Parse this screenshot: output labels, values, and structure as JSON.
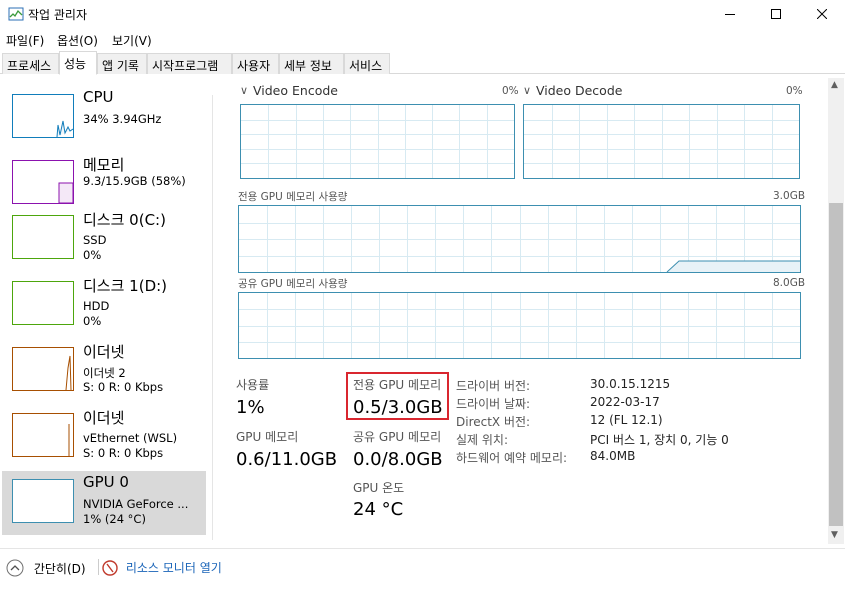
{
  "window": {
    "title": "작업 관리자"
  },
  "menu": [
    "파일(F)",
    "옵션(O)",
    "보기(V)"
  ],
  "tabs": [
    "프로세스",
    "성능",
    "앱 기록",
    "시작프로그램",
    "사용자",
    "세부 정보",
    "서비스"
  ],
  "sidebar": [
    {
      "title": "CPU",
      "sub1": "34% 3.94GHz",
      "sub2": "",
      "color": "#117dbb"
    },
    {
      "title": "메모리",
      "sub1": "9.3/15.9GB (58%)",
      "sub2": "",
      "color": "#8b12ae"
    },
    {
      "title": "디스크 0(C:)",
      "sub1": "SSD",
      "sub2": "0%",
      "color": "#4da60c"
    },
    {
      "title": "디스크 1(D:)",
      "sub1": "HDD",
      "sub2": "0%",
      "color": "#4da60c"
    },
    {
      "title": "이더넷",
      "sub1": "이더넷 2",
      "sub2": "S: 0 R: 0 Kbps",
      "color": "#a74f01"
    },
    {
      "title": "이더넷",
      "sub1": "vEthernet (WSL)",
      "sub2": "S: 0 R: 0 Kbps",
      "color": "#a74f01"
    },
    {
      "title": "GPU 0",
      "sub1": "NVIDIA GeForce ...",
      "sub2": "1% (24 °C)",
      "color": "#3d8fb0"
    }
  ],
  "graphs": {
    "video_encode": {
      "label": "Video Encode",
      "pct": "0%"
    },
    "video_decode": {
      "label": "Video Decode",
      "pct": "0%"
    },
    "dedicated": {
      "label": "전용 GPU 메모리 사용량",
      "max": "3.0GB"
    },
    "shared": {
      "label": "공유 GPU 메모리 사용량",
      "max": "8.0GB"
    }
  },
  "stats": {
    "usage_label": "사용률",
    "usage_value": "1%",
    "gpu_mem_label": "GPU 메모리",
    "gpu_mem_value": "0.6/11.0GB",
    "dedicated_label": "전용 GPU 메모리",
    "dedicated_value": "0.5/3.0GB",
    "shared_label": "공유 GPU 메모리",
    "shared_value": "0.0/8.0GB",
    "temp_label": "GPU 온도",
    "temp_value": "24 °C"
  },
  "info": [
    {
      "key": "드라이버 버전:",
      "value": "30.0.15.1215"
    },
    {
      "key": "드라이버 날짜:",
      "value": "2022-03-17"
    },
    {
      "key": "DirectX 버전:",
      "value": "12 (FL 12.1)"
    },
    {
      "key": "실제 위치:",
      "value": "PCI 버스 1, 장치 0, 기능 0"
    },
    {
      "key": "하드웨어 예약 메모리:",
      "value": "84.0MB"
    }
  ],
  "status": {
    "collapse": "간단히(D)",
    "monitor": "리소스 모니터 열기"
  },
  "colors": {
    "accent": "#3d8fb0",
    "highlight_box": "#d9262f"
  }
}
